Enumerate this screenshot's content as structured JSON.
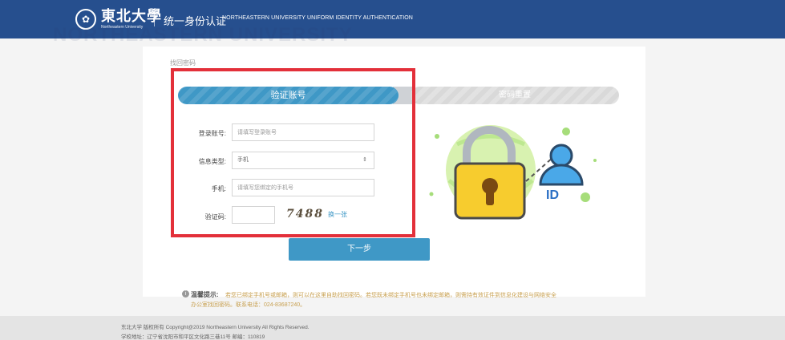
{
  "header": {
    "logo_cn": "東北大學",
    "logo_en": "Northeastern University",
    "title": "统一身份认证",
    "subtitle": "NORTHEASTERN UNIVERSITY UNIFORM IDENTITY AUTHENTICATION",
    "ghost_text": "NORTHEASTERN UNIVERSITY"
  },
  "page": {
    "heading": "找回密码"
  },
  "steps": [
    {
      "label": "验证账号",
      "active": true
    },
    {
      "label": "密码重置",
      "active": false
    }
  ],
  "form": {
    "account": {
      "label": "登录账号:",
      "placeholder": "请填写登录账号",
      "value": ""
    },
    "info_type": {
      "label": "信息类型:",
      "selected": "手机",
      "options": [
        "手机"
      ]
    },
    "phone": {
      "label": "手机:",
      "placeholder": "请填写您绑定的手机号",
      "value": ""
    },
    "captcha": {
      "label": "验证码:",
      "value": "",
      "image_text": "7488",
      "refresh_label": "换一张"
    }
  },
  "next_button": "下一步",
  "illustration": {
    "id_text": "ID"
  },
  "tip": {
    "title": "温馨提示:",
    "line1": "若您已绑定手机号或邮箱，则可以在这里自助找回密码。若您既未绑定手机号也未绑定邮箱，则需持有效证件到信息化建设与网络安全",
    "line2": "办公室找回密码。联系电话：024-83687240。"
  },
  "footer": {
    "line1": "东北大学 版权所有 Copyright@2019 Northeastern University All Rights Reserved.",
    "line2": "学校地址：辽宁省沈阳市和平区文化路三巷11号 邮编：110819"
  },
  "colors": {
    "header_bg": "#264f8e",
    "accent": "#3f98c6",
    "highlight": "#e3303a"
  }
}
